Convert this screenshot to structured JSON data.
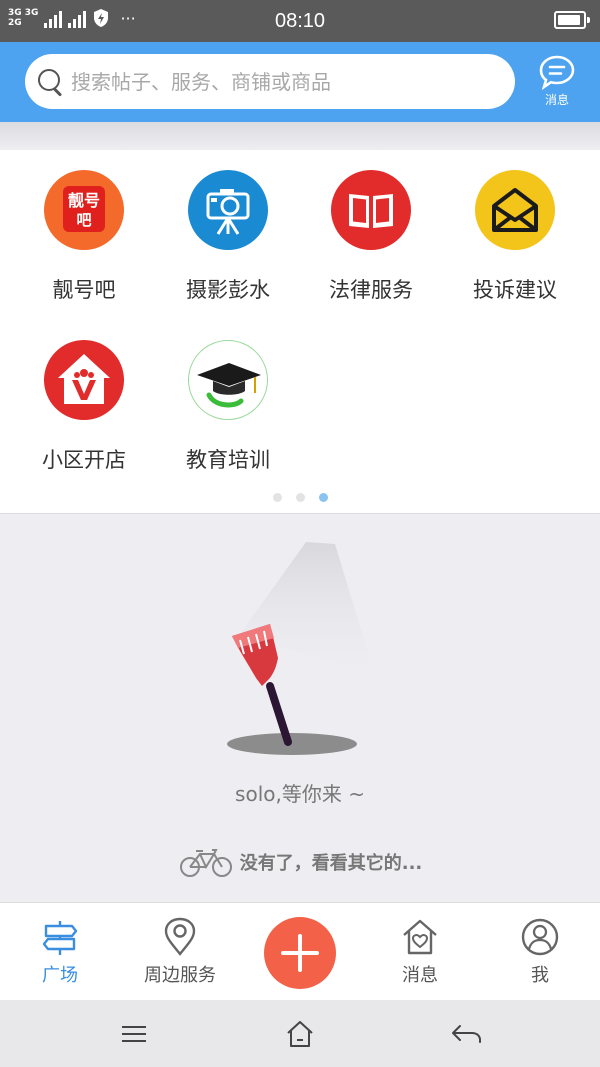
{
  "status_bar": {
    "network_top": "3G 3G",
    "network_bottom": "2G",
    "more": "···",
    "time": "08:10",
    "battery_level": 0.92
  },
  "header": {
    "search_placeholder": "搜索帖子、服务、商铺或商品",
    "message_label": "消息"
  },
  "categories": [
    {
      "label": "靓号吧",
      "icon": "lianghao-logo-icon",
      "color": "#f36a2a",
      "logo_text_1": "靓号",
      "logo_text_2": "吧"
    },
    {
      "label": "摄影彭水",
      "icon": "camera-icon",
      "color": "#1a8ad3"
    },
    {
      "label": "法律服务",
      "icon": "book-icon",
      "color": "#e22b2b"
    },
    {
      "label": "投诉建议",
      "icon": "envelope-icon",
      "color": "#f3c419"
    },
    {
      "label": "小区开店",
      "icon": "shop-house-icon",
      "color": "#e22b2b"
    },
    {
      "label": "教育培训",
      "icon": "graduation-cap-icon",
      "color": "#ffffff"
    }
  ],
  "pager": {
    "count": 3,
    "active_index": 2
  },
  "empty_state": {
    "text": "solo,等你来 ~",
    "end_text": "没有了，看看其它的..."
  },
  "bottom_nav": {
    "items": [
      {
        "label": "广场",
        "icon": "signpost-icon",
        "active": true
      },
      {
        "label": "周边服务",
        "icon": "location-pin-icon",
        "active": false
      },
      {
        "label": "消息",
        "icon": "house-heart-icon",
        "active": false
      },
      {
        "label": "我",
        "icon": "user-icon",
        "active": false
      }
    ]
  },
  "colors": {
    "header_blue": "#4da3ef",
    "active_nav": "#3a8ee0",
    "fab": "#f26148"
  }
}
